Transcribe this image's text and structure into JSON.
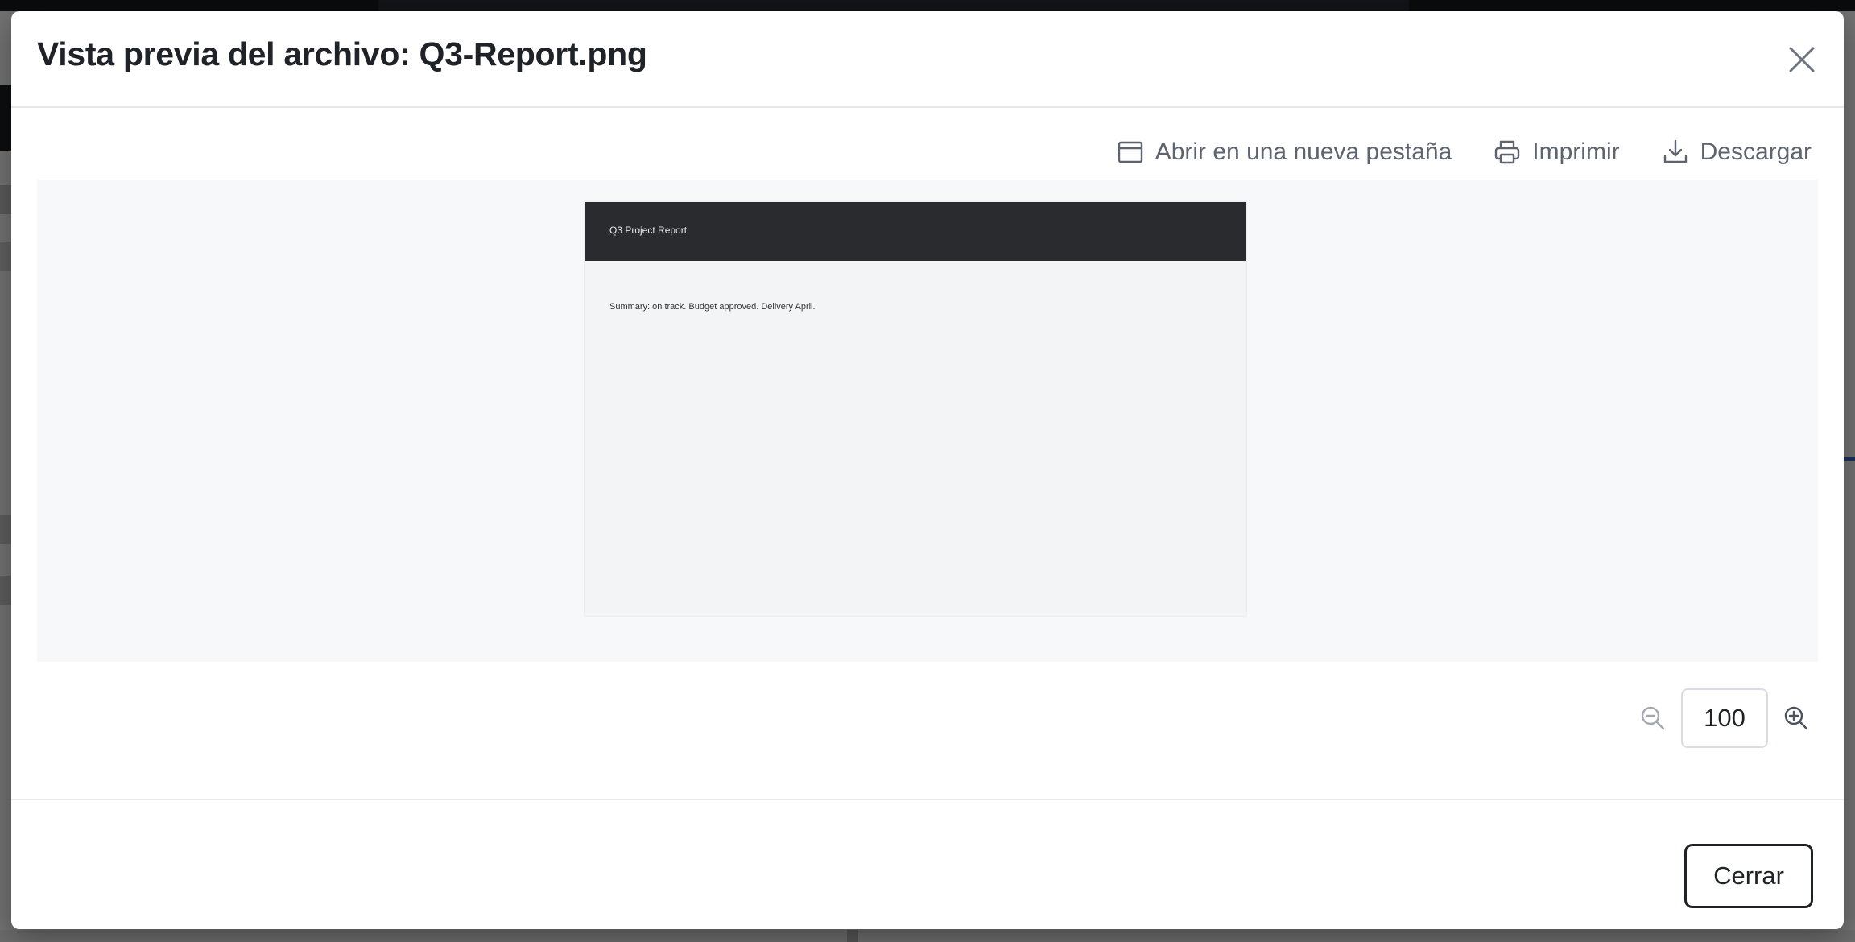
{
  "modal": {
    "title": "Vista previa del archivo: Q3-Report.png",
    "close_icon": "close-icon"
  },
  "toolbar": {
    "open_new_tab_label": "Abrir en una nueva pestaña",
    "open_new_tab_icon": "window-icon",
    "print_label": "Imprimir",
    "print_icon": "printer-icon",
    "download_label": "Descargar",
    "download_icon": "download-icon"
  },
  "preview": {
    "image_title": "Q3 Project Report",
    "image_summary": "Summary: on track. Budget approved. Delivery April."
  },
  "zoom": {
    "value": "100",
    "zoom_out_icon": "zoom-out-icon",
    "zoom_in_icon": "zoom-in-icon"
  },
  "footer": {
    "close_label": "Cerrar"
  },
  "colors": {
    "title_text": "#1f2328",
    "toolbar_text": "#5d6470",
    "preview_background": "#f7f8fa",
    "image_header": "#2a2b2e",
    "overlay": "rgba(0,0,0,0.55)"
  }
}
